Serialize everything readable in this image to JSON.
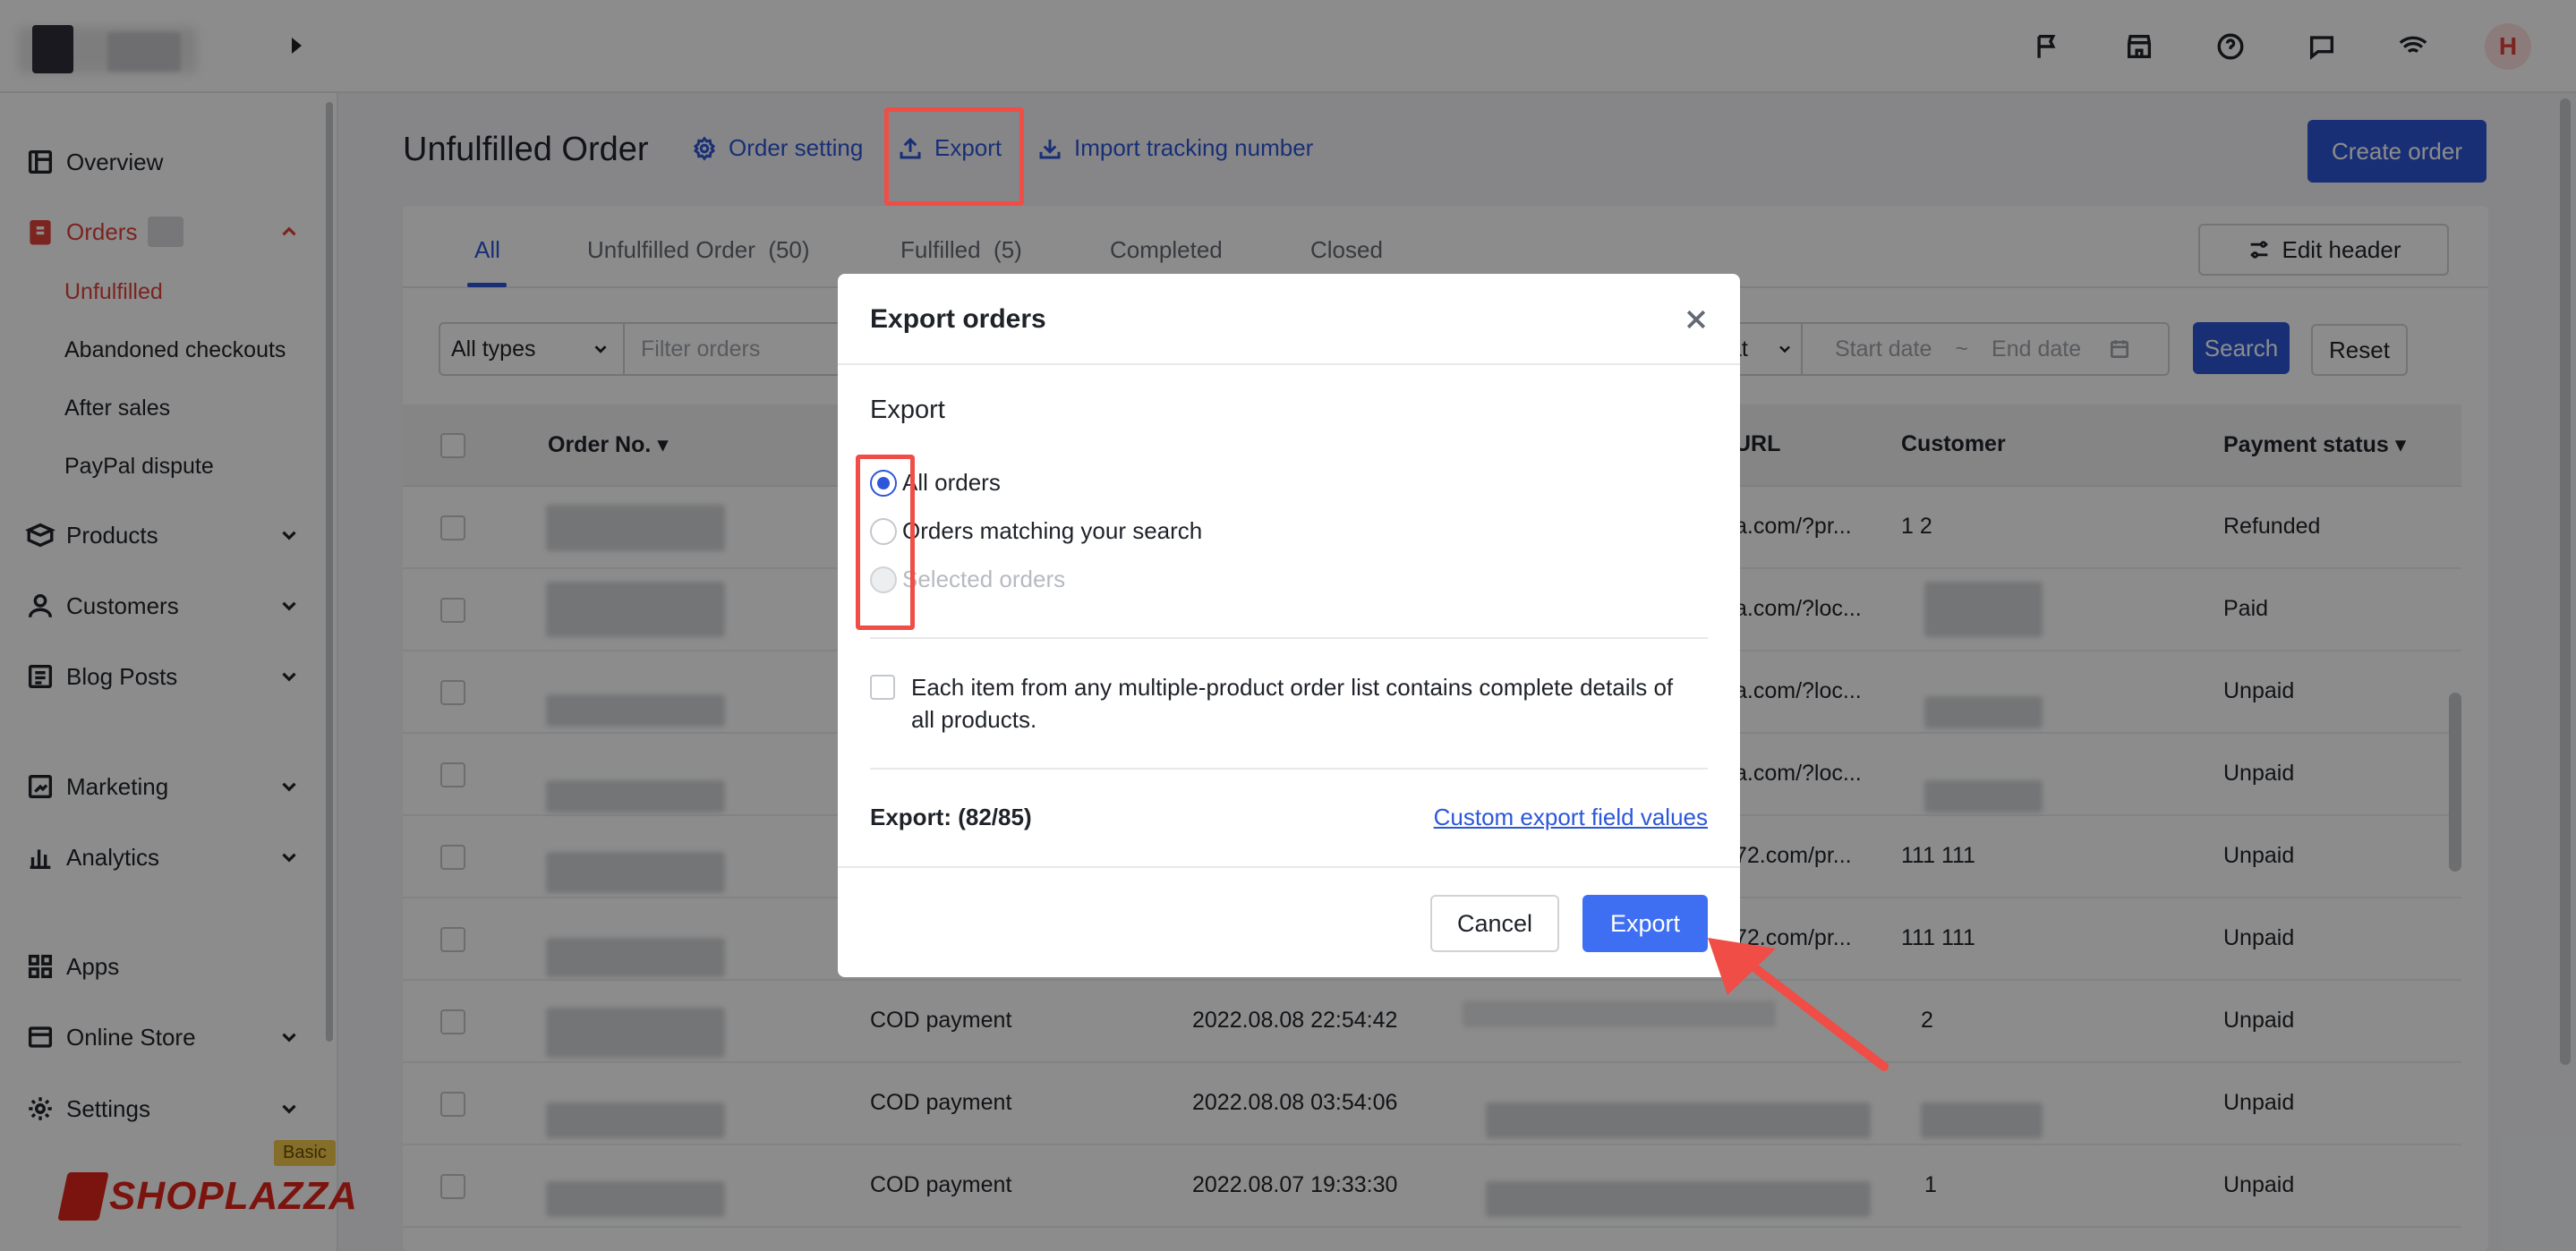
{
  "topbar": {
    "icons": [
      "flag-icon",
      "store-icon",
      "help-icon",
      "message-icon",
      "wifi-icon"
    ],
    "avatar_initial": "H"
  },
  "sidebar": {
    "items": [
      {
        "label": "Overview",
        "icon": "overview-icon"
      },
      {
        "label": "Orders",
        "icon": "orders-icon"
      },
      {
        "label": "Products",
        "icon": "products-icon"
      },
      {
        "label": "Customers",
        "icon": "customers-icon"
      },
      {
        "label": "Blog Posts",
        "icon": "blog-icon"
      },
      {
        "label": "Marketing",
        "icon": "marketing-icon"
      },
      {
        "label": "Analytics",
        "icon": "analytics-icon"
      },
      {
        "label": "Apps",
        "icon": "apps-icon"
      },
      {
        "label": "Online Store",
        "icon": "store-icon"
      },
      {
        "label": "Settings",
        "icon": "settings-icon"
      }
    ],
    "order_subitems": [
      "Unfulfilled",
      "Abandoned checkouts",
      "After sales",
      "PayPal dispute"
    ],
    "plan_badge": "Basic",
    "logo_text": "SHOPLAZZA"
  },
  "header": {
    "title": "Unfulfilled Order",
    "order_setting": "Order setting",
    "export": "Export",
    "import_tracking": "Import tracking number",
    "create_order": "Create order"
  },
  "tabs": [
    {
      "label": "All",
      "count": ""
    },
    {
      "label": "Unfulfilled Order",
      "count": "(50)"
    },
    {
      "label": "Fulfilled",
      "count": "(5)"
    },
    {
      "label": "Completed",
      "count": ""
    },
    {
      "label": "Closed",
      "count": ""
    }
  ],
  "edit_header": "Edit header",
  "filters": {
    "type_select": "All types",
    "search_placeholder": "Filter orders",
    "format_partial": "at",
    "start_date": "Start date",
    "date_sep": "~",
    "end_date": "End date",
    "search_btn": "Search",
    "reset_btn": "Reset"
  },
  "table": {
    "headers": {
      "order_no": "Order No.",
      "url": "URL",
      "customer": "Customer",
      "payment_status": "Payment status"
    },
    "rows": [
      {
        "payment_method": "",
        "date": "",
        "url": "a.com/?pr...",
        "customer": "1 2",
        "payment_status": "Refunded"
      },
      {
        "payment_method": "",
        "date": "",
        "url": "a.com/?loc...",
        "customer": "",
        "payment_status": "Paid"
      },
      {
        "payment_method": "",
        "date": "",
        "url": "a.com/?loc...",
        "customer": "",
        "payment_status": "Unpaid"
      },
      {
        "payment_method": "",
        "date": "",
        "url": "a.com/?loc...",
        "customer": "",
        "payment_status": "Unpaid"
      },
      {
        "payment_method": "",
        "date": "",
        "url": "72.com/pr...",
        "customer": "111 111",
        "payment_status": "Unpaid"
      },
      {
        "payment_method": "",
        "date": "",
        "url": "72.com/pr...",
        "customer": "111 111",
        "payment_status": "Unpaid"
      },
      {
        "payment_method": "COD payment",
        "date": "2022.08.08 22:54:42",
        "url": "",
        "customer": "2",
        "payment_status": "Unpaid"
      },
      {
        "payment_method": "COD payment",
        "date": "2022.08.08 03:54:06",
        "url": "",
        "customer": "",
        "payment_status": "Unpaid"
      },
      {
        "payment_method": "COD payment",
        "date": "2022.08.07 19:33:30",
        "url": "",
        "customer": "1",
        "payment_status": "Unpaid"
      }
    ]
  },
  "modal": {
    "title": "Export orders",
    "section": "Export",
    "options": [
      {
        "label": "All orders",
        "checked": true,
        "disabled": false
      },
      {
        "label": "Orders matching your search",
        "checked": false,
        "disabled": false
      },
      {
        "label": "Selected orders",
        "checked": false,
        "disabled": true
      }
    ],
    "detail_checkbox": "Each item from any multiple-product order list contains complete details of all products.",
    "export_count": "Export: (82/85)",
    "custom_link": "Custom export field values",
    "cancel": "Cancel",
    "export": "Export"
  },
  "colors": {
    "primary": "#2d57d8",
    "export_button": "#3e6ff2",
    "active_red": "#e0423b",
    "annotation_red": "#ef4d46"
  }
}
